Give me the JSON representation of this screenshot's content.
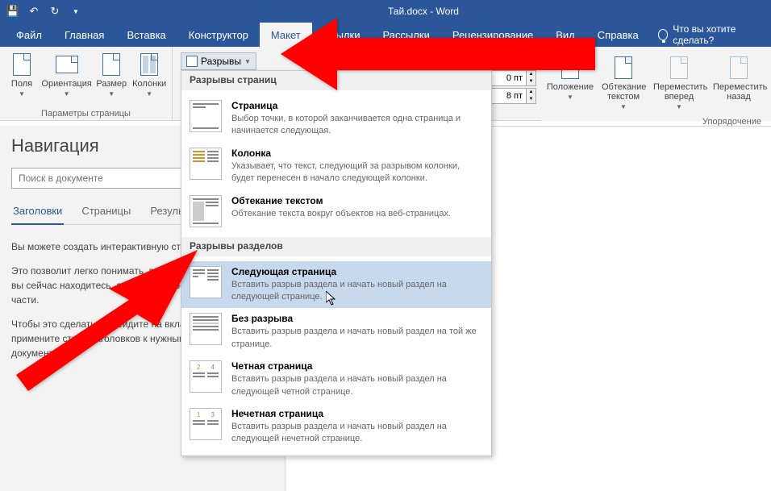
{
  "title": "Тай.docx - Word",
  "tabs": [
    "Файл",
    "Главная",
    "Вставка",
    "Конструктор",
    "Макет",
    "Ссылки",
    "Рассылки",
    "Рецензирование",
    "Вид",
    "Справка"
  ],
  "active_tab": 4,
  "tell_me": "Что вы хотите сделать?",
  "ribbon": {
    "group1_label": "Параметры страницы",
    "btn_fields": "Поля",
    "btn_orientation": "Ориентация",
    "btn_size": "Размер",
    "btn_columns": "Колонки",
    "breaks": "Разрывы",
    "group3": {
      "position": "Положение",
      "wrap": "Обтекание текстом",
      "forward": "Переместить вперед",
      "backward": "Переместить назад",
      "label": "Упорядочение"
    },
    "spacing": {
      "before": "0 пт",
      "after": "8 пт"
    }
  },
  "dropdown": {
    "section1": "Разрывы страниц",
    "section2": "Разрывы разделов",
    "items": [
      {
        "title": "Страница",
        "desc": "Выбор точки, в которой заканчивается одна страница и начинается следующая."
      },
      {
        "title": "Колонка",
        "desc": "Указывает, что текст, следующий за разрывом колонки, будет перенесен в начало следующей колонки."
      },
      {
        "title": "Обтекание текстом",
        "desc": "Обтекание текста вокруг объектов на веб-страницах."
      },
      {
        "title": "Следующая страница",
        "desc": "Вставить разрыв раздела и начать новый раздел на следующей странице."
      },
      {
        "title": "Без разрыва",
        "desc": "Вставить разрыв раздела и начать новый раздел на той же странице."
      },
      {
        "title": "Четная страница",
        "desc": "Вставить разрыв раздела и начать новый раздел на следующей четной странице."
      },
      {
        "title": "Нечетная страница",
        "desc": "Вставить разрыв раздела и начать новый раздел на следующей нечетной странице."
      }
    ]
  },
  "nav": {
    "title": "Навигация",
    "search_placeholder": "Поиск в документе",
    "tabs": [
      "Заголовки",
      "Страницы",
      "Результаты"
    ],
    "active": 0,
    "p1": "Вы можете создать интерактивную структуру документа.",
    "p2": "Это позволит легко понимать, в каком месте документа вы сейчас находитесь, а также быстро перемещать его части.",
    "p3": "Чтобы это сделать, перейдите на вкладку \"Главная\" и примените стили заголовков к нужным частям в вашем документе."
  }
}
